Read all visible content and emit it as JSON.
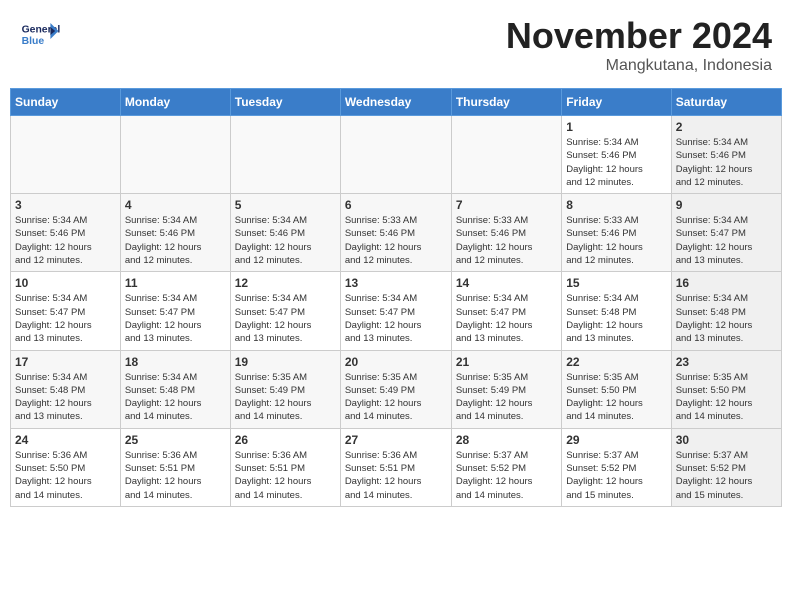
{
  "header": {
    "logo_line1": "General",
    "logo_line2": "Blue",
    "month": "November 2024",
    "location": "Mangkutana, Indonesia"
  },
  "days_of_week": [
    "Sunday",
    "Monday",
    "Tuesday",
    "Wednesday",
    "Thursday",
    "Friday",
    "Saturday"
  ],
  "weeks": [
    [
      {
        "day": "",
        "info": ""
      },
      {
        "day": "",
        "info": ""
      },
      {
        "day": "",
        "info": ""
      },
      {
        "day": "",
        "info": ""
      },
      {
        "day": "",
        "info": ""
      },
      {
        "day": "1",
        "info": "Sunrise: 5:34 AM\nSunset: 5:46 PM\nDaylight: 12 hours\nand 12 minutes."
      },
      {
        "day": "2",
        "info": "Sunrise: 5:34 AM\nSunset: 5:46 PM\nDaylight: 12 hours\nand 12 minutes."
      }
    ],
    [
      {
        "day": "3",
        "info": "Sunrise: 5:34 AM\nSunset: 5:46 PM\nDaylight: 12 hours\nand 12 minutes."
      },
      {
        "day": "4",
        "info": "Sunrise: 5:34 AM\nSunset: 5:46 PM\nDaylight: 12 hours\nand 12 minutes."
      },
      {
        "day": "5",
        "info": "Sunrise: 5:34 AM\nSunset: 5:46 PM\nDaylight: 12 hours\nand 12 minutes."
      },
      {
        "day": "6",
        "info": "Sunrise: 5:33 AM\nSunset: 5:46 PM\nDaylight: 12 hours\nand 12 minutes."
      },
      {
        "day": "7",
        "info": "Sunrise: 5:33 AM\nSunset: 5:46 PM\nDaylight: 12 hours\nand 12 minutes."
      },
      {
        "day": "8",
        "info": "Sunrise: 5:33 AM\nSunset: 5:46 PM\nDaylight: 12 hours\nand 12 minutes."
      },
      {
        "day": "9",
        "info": "Sunrise: 5:34 AM\nSunset: 5:47 PM\nDaylight: 12 hours\nand 13 minutes."
      }
    ],
    [
      {
        "day": "10",
        "info": "Sunrise: 5:34 AM\nSunset: 5:47 PM\nDaylight: 12 hours\nand 13 minutes."
      },
      {
        "day": "11",
        "info": "Sunrise: 5:34 AM\nSunset: 5:47 PM\nDaylight: 12 hours\nand 13 minutes."
      },
      {
        "day": "12",
        "info": "Sunrise: 5:34 AM\nSunset: 5:47 PM\nDaylight: 12 hours\nand 13 minutes."
      },
      {
        "day": "13",
        "info": "Sunrise: 5:34 AM\nSunset: 5:47 PM\nDaylight: 12 hours\nand 13 minutes."
      },
      {
        "day": "14",
        "info": "Sunrise: 5:34 AM\nSunset: 5:47 PM\nDaylight: 12 hours\nand 13 minutes."
      },
      {
        "day": "15",
        "info": "Sunrise: 5:34 AM\nSunset: 5:48 PM\nDaylight: 12 hours\nand 13 minutes."
      },
      {
        "day": "16",
        "info": "Sunrise: 5:34 AM\nSunset: 5:48 PM\nDaylight: 12 hours\nand 13 minutes."
      }
    ],
    [
      {
        "day": "17",
        "info": "Sunrise: 5:34 AM\nSunset: 5:48 PM\nDaylight: 12 hours\nand 13 minutes."
      },
      {
        "day": "18",
        "info": "Sunrise: 5:34 AM\nSunset: 5:48 PM\nDaylight: 12 hours\nand 14 minutes."
      },
      {
        "day": "19",
        "info": "Sunrise: 5:35 AM\nSunset: 5:49 PM\nDaylight: 12 hours\nand 14 minutes."
      },
      {
        "day": "20",
        "info": "Sunrise: 5:35 AM\nSunset: 5:49 PM\nDaylight: 12 hours\nand 14 minutes."
      },
      {
        "day": "21",
        "info": "Sunrise: 5:35 AM\nSunset: 5:49 PM\nDaylight: 12 hours\nand 14 minutes."
      },
      {
        "day": "22",
        "info": "Sunrise: 5:35 AM\nSunset: 5:50 PM\nDaylight: 12 hours\nand 14 minutes."
      },
      {
        "day": "23",
        "info": "Sunrise: 5:35 AM\nSunset: 5:50 PM\nDaylight: 12 hours\nand 14 minutes."
      }
    ],
    [
      {
        "day": "24",
        "info": "Sunrise: 5:36 AM\nSunset: 5:50 PM\nDaylight: 12 hours\nand 14 minutes."
      },
      {
        "day": "25",
        "info": "Sunrise: 5:36 AM\nSunset: 5:51 PM\nDaylight: 12 hours\nand 14 minutes."
      },
      {
        "day": "26",
        "info": "Sunrise: 5:36 AM\nSunset: 5:51 PM\nDaylight: 12 hours\nand 14 minutes."
      },
      {
        "day": "27",
        "info": "Sunrise: 5:36 AM\nSunset: 5:51 PM\nDaylight: 12 hours\nand 14 minutes."
      },
      {
        "day": "28",
        "info": "Sunrise: 5:37 AM\nSunset: 5:52 PM\nDaylight: 12 hours\nand 14 minutes."
      },
      {
        "day": "29",
        "info": "Sunrise: 5:37 AM\nSunset: 5:52 PM\nDaylight: 12 hours\nand 15 minutes."
      },
      {
        "day": "30",
        "info": "Sunrise: 5:37 AM\nSunset: 5:52 PM\nDaylight: 12 hours\nand 15 minutes."
      }
    ]
  ]
}
